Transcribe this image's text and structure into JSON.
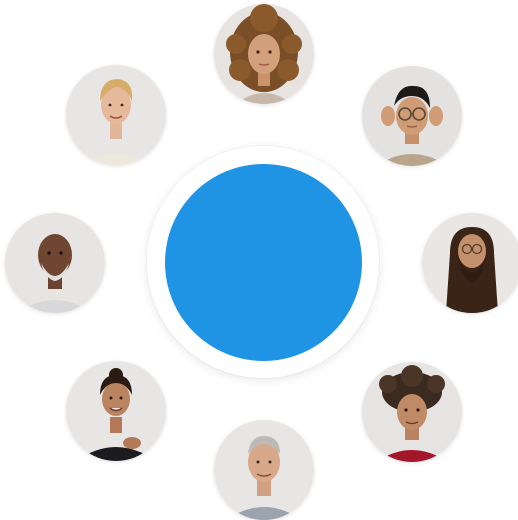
{
  "center": {
    "color": "#1f94e4"
  },
  "avatars": [
    {
      "position": "top",
      "icon": "woman-curly-hair-avatar-icon"
    },
    {
      "position": "upper-right",
      "icon": "man-adjusting-glasses-avatar-icon"
    },
    {
      "position": "right",
      "icon": "man-long-hair-beard-avatar-icon"
    },
    {
      "position": "lower-right",
      "icon": "man-red-shirt-avatar-icon"
    },
    {
      "position": "bottom",
      "icon": "older-man-polo-avatar-icon"
    },
    {
      "position": "lower-left",
      "icon": "woman-black-top-avatar-icon"
    },
    {
      "position": "left",
      "icon": "older-man-white-beard-avatar-icon"
    },
    {
      "position": "upper-left",
      "icon": "older-woman-blonde-avatar-icon"
    }
  ]
}
